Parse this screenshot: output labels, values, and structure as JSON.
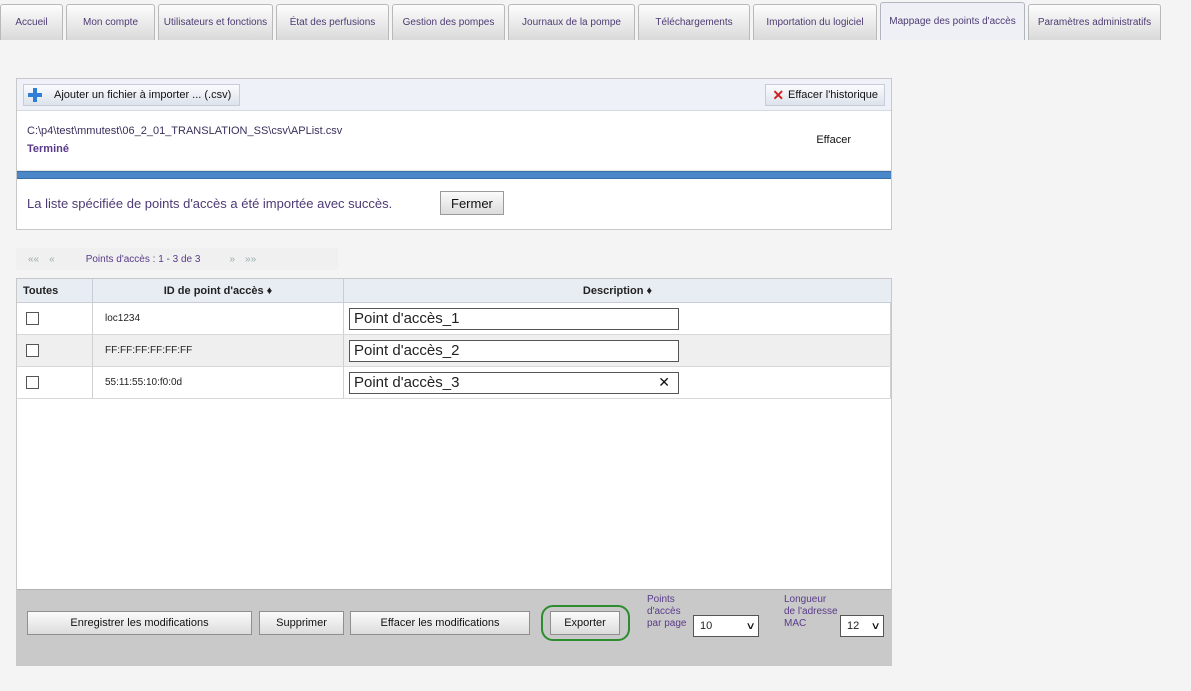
{
  "tabs": [
    {
      "label": "Accueil"
    },
    {
      "label": "Mon compte"
    },
    {
      "label": "Utilisateurs et fonctions"
    },
    {
      "label": "État des perfusions"
    },
    {
      "label": "Gestion des pompes"
    },
    {
      "label": "Journaux de la pompe"
    },
    {
      "label": "Téléchargements"
    },
    {
      "label": "Importation du logiciel"
    },
    {
      "label": "Mappage des points d'accès"
    },
    {
      "label": "Paramètres administratifs"
    }
  ],
  "import": {
    "add_label": "Ajouter un fichier à importer ... (.csv)",
    "clear_history_label": "Effacer l'historique",
    "file_path": "C:\\p4\\test\\mmutest\\06_2_01_TRANSLATION_SS\\csv\\APList.csv",
    "file_status": "Terminé",
    "file_clear_label": "Effacer",
    "progress": 1.0,
    "success_message": "La liste spécifiée de points d'accès a été importée avec succès.",
    "close_label": "Fermer"
  },
  "pager": {
    "first": "««",
    "prev": "«",
    "text": "Points d'accès : 1 - 3 de 3",
    "next": "»",
    "last": "»»"
  },
  "table": {
    "headers": {
      "all": "Toutes",
      "id": "ID de point d'accès ♦",
      "description": "Description ♦"
    },
    "rows": [
      {
        "id": "loc1234",
        "description": "Point d'accès_1"
      },
      {
        "id": "FF:FF:FF:FF:FF:FF",
        "description": "Point d'accès_2"
      },
      {
        "id": "55:11:55:10:f0:0d",
        "description": "Point d'accès_3"
      }
    ]
  },
  "footer": {
    "save_label": "Enregistrer les modifications",
    "delete_label": "Supprimer",
    "clear_changes_label": "Effacer les modifications",
    "export_label": "Exporter",
    "per_page_label": "Points d'accès par page",
    "per_page_value": "10",
    "mac_length_label": "Longueur de l'adresse MAC",
    "mac_length_value": "12"
  },
  "colors": {
    "accent_text": "#5a3a8a",
    "progress_blue": "#4a86c8",
    "export_highlight": "#2e8b2e",
    "clear_x_red": "#d02020"
  }
}
